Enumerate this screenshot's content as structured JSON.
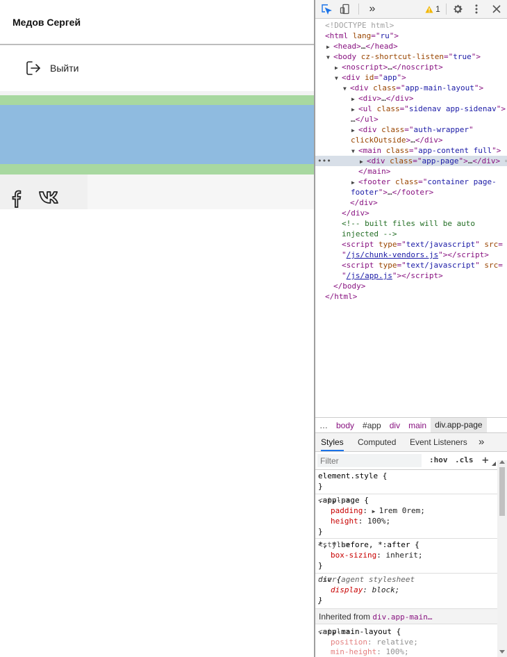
{
  "page": {
    "user_name": "Медов Сергей",
    "logout_label": "Выйти",
    "social": [
      "facebook",
      "vk"
    ]
  },
  "devtools": {
    "toolbar": {
      "more_tabs": "»",
      "warning_count": "1"
    },
    "dom": {
      "doctype": "<!DOCTYPE html>",
      "html_tag": "html",
      "html_attr": "lang",
      "html_val": "ru",
      "head": "head",
      "body_attr": "cz-shortcut-listen",
      "body_val": "true",
      "noscript": "noscript",
      "div_id": "app",
      "layout_class": "app-main-layout",
      "ul_class": "sidenav app-sidenav",
      "auth_class": "auth-wrapper",
      "auth_extra": "clickOutside",
      "main_class": "app-content full",
      "page_class": "app-page",
      "footer_class": "container page-",
      "footer_cont": "footer",
      "comment1": "<!-- built files will be auto",
      "comment2": "injected -->",
      "script_type": "text/javascript",
      "src1": "/js/chunk-vendors.js",
      "src2": "/js/app.js",
      "ellipsis_marker": "…",
      "selected_eq": "="
    },
    "breadcrumb": [
      "…",
      "body",
      "#app",
      "div",
      "main",
      "div.app-page"
    ],
    "tabs": [
      "Styles",
      "Computed",
      "Event Listeners",
      "»"
    ],
    "filter": {
      "placeholder": "Filter",
      "hov": ":hov",
      "cls": ".cls",
      "add": "+"
    },
    "styles": {
      "element_style": "element.style {",
      "app_page_selector": ".app-page {",
      "app_page_source": "<style>",
      "padding_prop": "padding",
      "padding_val": "1rem 0rem;",
      "height_prop": "height",
      "height_val": "100%;",
      "universal_selector": "*, *:before, *:after {",
      "universal_source": "<style>",
      "box_sizing_prop": "box-sizing",
      "box_sizing_val": "inherit;",
      "div_selector": "div {",
      "div_source": "user agent stylesheet",
      "display_prop": "display",
      "display_val": "block;",
      "inherited_label": "Inherited from",
      "inherited_from": "div.app-main…",
      "layout_selector": ".app-main-layout {",
      "layout_source": "<style>",
      "position_prop": "position",
      "position_val": "relative;",
      "min_height_prop": "min-height",
      "min_height_val": "100%;",
      "close_brace": "}"
    }
  }
}
